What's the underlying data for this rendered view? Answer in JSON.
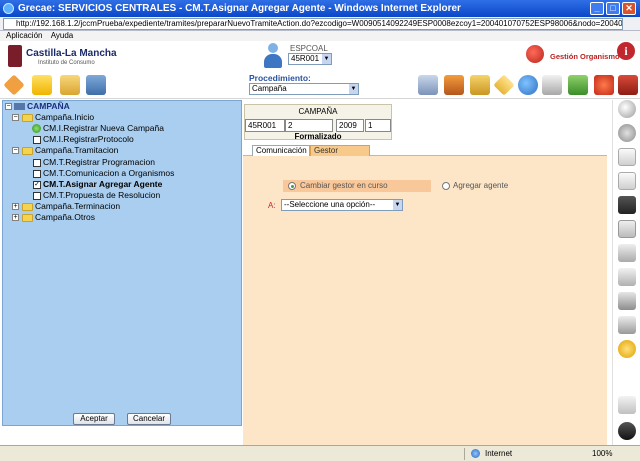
{
  "window": {
    "title": "Grecae: SERVICIOS CENTRALES - CM.T.Asignar Agregar Agente - Windows Internet Explorer",
    "url": "http://192.168.1.2/jccmPrueba/expediente/tramites/prepararNuevoTramiteAction.do?ezcodigo=W0090514092249ESP0008ezcoy1=200401070752ESP98006&nodo=200405131254ESP08353#"
  },
  "menu": {
    "aplicacion": "Aplicación",
    "ayuda": "Ayuda"
  },
  "header": {
    "logo_title": "Castilla-La Mancha",
    "logo_subtitle": "Instituto de Consumo",
    "user_label": "ESPCOAL",
    "user_select": "45R001",
    "gestion": "Gestión Organismo",
    "info_icon": "i"
  },
  "toolbar": {
    "procedimiento_label": "Procedimiento:",
    "procedimiento_value": "Campaña"
  },
  "record": {
    "title": "CAMPAÑA",
    "field1": "45R001",
    "field2": "2",
    "field3": "2009",
    "field4": "1",
    "status": "Formalizado"
  },
  "tabs": {
    "comunicacion": "Comunicación",
    "gestor": "Gestor"
  },
  "form": {
    "radio1": "Cambiar gestor en curso",
    "radio2": "Agregar agente",
    "a_label": "A:",
    "a_select": "--Seleccione una opción--"
  },
  "tree": {
    "root": "CAMPAÑA",
    "n1": "Campaña.Inicio",
    "n1a": "CM.I.Registrar Nueva Campaña",
    "n1b": "CM.I.RegistrarProtocolo",
    "n2": "Campaña.Tramitacion",
    "n2a": "CM.T.Registrar Programacion",
    "n2b": "CM.T.Comunicacion a Organismos",
    "n2c": "CM.T.Asignar Agregar Agente",
    "n2d": "CM.T.Propuesta de Resolucion",
    "n3": "Campaña.Terminacion",
    "n4": "Campaña.Otros",
    "accept": "Aceptar",
    "cancel": "Cancelar"
  },
  "status": {
    "zone": "Internet",
    "zoom": "100%"
  }
}
